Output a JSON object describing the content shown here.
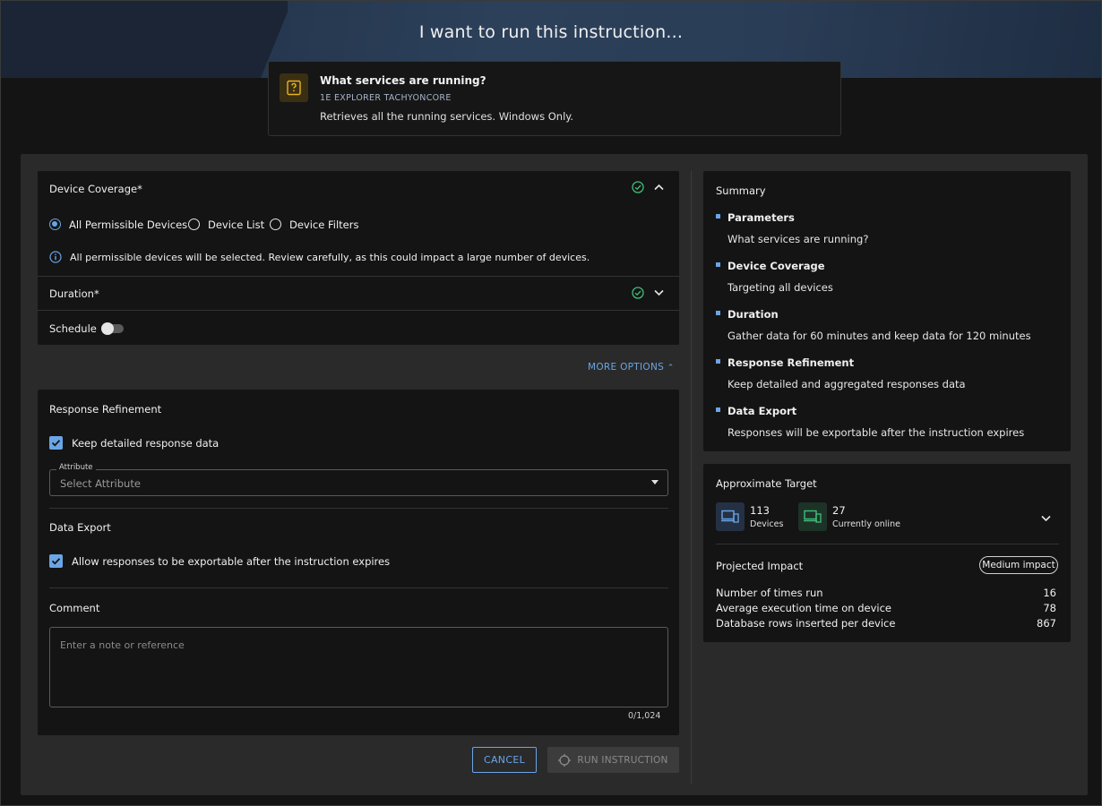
{
  "header": {
    "title": "I want to run this instruction..."
  },
  "instruction": {
    "name": "What services are running?",
    "product": "1E EXPLORER TACHYONCORE",
    "description": "Retrieves all the running services. Windows Only."
  },
  "device_coverage": {
    "label": "Device Coverage*",
    "options": [
      "All Permissible Devices",
      "Device List",
      "Device Filters"
    ],
    "selected": "All Permissible Devices",
    "info": "All permissible devices will be selected. Review carefully, as this could impact a large number of devices."
  },
  "duration": {
    "label": "Duration*"
  },
  "schedule": {
    "label": "Schedule"
  },
  "more_options": {
    "label": "MORE OPTIONS"
  },
  "response_refinement": {
    "title": "Response Refinement",
    "keep_detailed_label": "Keep detailed response data",
    "attribute_label": "Attribute",
    "attribute_placeholder": "Select Attribute"
  },
  "data_export": {
    "title": "Data Export",
    "allow_label": "Allow responses to be exportable after the instruction expires"
  },
  "comment": {
    "title": "Comment",
    "placeholder": "Enter a note or reference",
    "counter": "0/1,024"
  },
  "actions": {
    "cancel": "CANCEL",
    "run": "RUN INSTRUCTION"
  },
  "summary": {
    "title": "Summary",
    "items": [
      {
        "head": "Parameters",
        "text": "What services are running?"
      },
      {
        "head": "Device Coverage",
        "text": "Targeting all devices"
      },
      {
        "head": "Duration",
        "text": "Gather data for 60 minutes and keep data for 120 minutes"
      },
      {
        "head": "Response Refinement",
        "text": "Keep detailed and aggregated responses data"
      },
      {
        "head": "Data Export",
        "text": "Responses will be exportable after the instruction expires"
      }
    ]
  },
  "target": {
    "title": "Approximate Target",
    "devices_count": "113",
    "devices_label": "Devices",
    "online_count": "27",
    "online_label": "Currently online",
    "projected_label": "Projected Impact",
    "impact_badge": "Medium impact",
    "metrics": [
      {
        "label": "Number of times run",
        "value": "16"
      },
      {
        "label": "Average execution time on device",
        "value": "78"
      },
      {
        "label": "Database rows inserted per device",
        "value": "867"
      }
    ]
  },
  "colors": {
    "accent": "#6aa5e6",
    "success": "#3fbf7a",
    "instruction_icon": "#e6b422"
  }
}
